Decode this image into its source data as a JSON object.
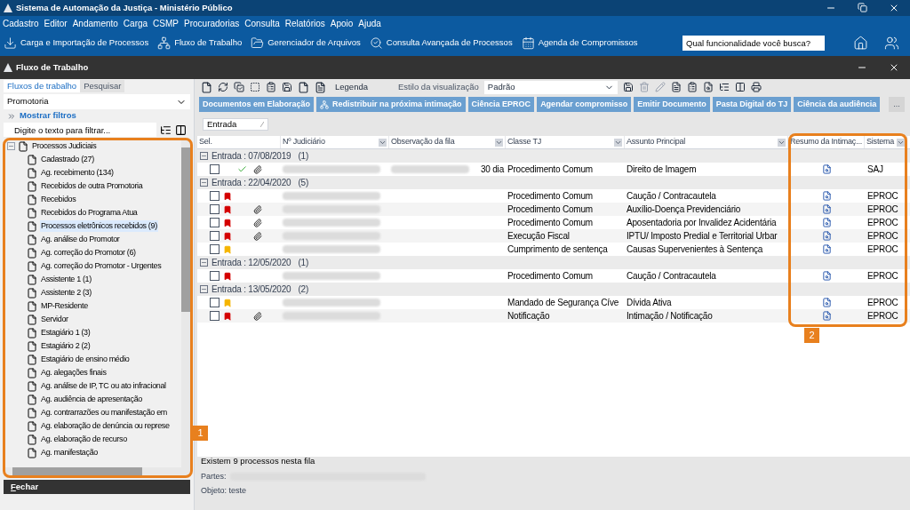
{
  "window": {
    "title": "Sistema de Automação da Justiça - Ministério Público"
  },
  "menu": [
    "Cadastro",
    "Editor",
    "Andamento",
    "Carga",
    "CSMP",
    "Procuradorias",
    "Consulta",
    "Relatórios",
    "Apoio",
    "Ajuda"
  ],
  "toolbar": [
    {
      "kind": "download",
      "label": "Carga e Importação de Processos"
    },
    {
      "kind": "flow",
      "label": "Fluxo de Trabalho"
    },
    {
      "kind": "folder",
      "label": "Gerenciador de Arquivos"
    },
    {
      "kind": "search",
      "label": "Consulta Avançada de Processos"
    },
    {
      "kind": "calendar",
      "label": "Agenda de Compromissos"
    }
  ],
  "search": {
    "placeholder": "Qual funcionalidade você busca?"
  },
  "subwindow": {
    "title": "Fluxo de Trabalho"
  },
  "sidebar": {
    "tabs": [
      {
        "label": "Fluxos de trabalho",
        "selected": true
      },
      {
        "label": "Pesquisar",
        "selected": false
      }
    ],
    "dropdown": "Promotoria",
    "filters_link": "Mostrar filtros",
    "filter": {
      "placeholder": "Digite o texto para filtrar..."
    },
    "tree": [
      {
        "label": "Processos Judiciais",
        "expanded": true,
        "selected": false,
        "children": [
          {
            "label": "Cadastrado (27)",
            "selected": false
          },
          {
            "label": "Ag. recebimento (134)",
            "selected": false
          },
          {
            "label": "Recebidos de outra Promotoria",
            "selected": false
          },
          {
            "label": "Recebidos",
            "selected": false
          },
          {
            "label": "Recebidos do Programa Atua",
            "selected": false
          },
          {
            "label": "Processos eletrônicos recebidos (9)",
            "selected": true
          },
          {
            "label": "Ag. análise do Promotor",
            "selected": false
          },
          {
            "label": "Ag. correção do Promotor (6)",
            "selected": false
          },
          {
            "label": "Ag. correção do Promotor - Urgentes",
            "selected": false
          },
          {
            "label": "Assistente 1 (1)",
            "selected": false
          },
          {
            "label": "Assistente 2 (3)",
            "selected": false
          },
          {
            "label": "MP-Residente",
            "selected": false
          },
          {
            "label": "Servidor",
            "selected": false
          },
          {
            "label": "Estagiário 1 (3)",
            "selected": false
          },
          {
            "label": "Estagiário 2 (2)",
            "selected": false
          },
          {
            "label": "Estagiário de ensino médio",
            "selected": false
          },
          {
            "label": "Ag. alegações finais",
            "selected": false
          },
          {
            "label": "Ag. análise de IP, TC ou ato infracional",
            "selected": false
          },
          {
            "label": "Ag. audiência de apresentação",
            "selected": false
          },
          {
            "label": "Ag. contrarrazões ou manifestação em",
            "selected": false
          },
          {
            "label": "Ag. elaboração de denúncia ou represe",
            "selected": false
          },
          {
            "label": "Ag. elaboração de recurso",
            "selected": false
          },
          {
            "label": "Ag. manifestação",
            "selected": false
          }
        ]
      }
    ],
    "close_button": "Fechar"
  },
  "main": {
    "legend": "Legenda",
    "view_style_label": "Estilo da visualização",
    "view_style": "Padrão",
    "actions": [
      "Documentos em Elaboração",
      "Redistribuir na próxima intimação",
      "Ciência EPROC",
      "Agendar compromisso",
      "Emitir Documento",
      "Pasta Digital do TJ",
      "Ciência da audiência"
    ],
    "more": "...",
    "group_by": "Entrada",
    "table": {
      "columns": [
        "Sel.",
        "Nº Judiciário",
        "Observação da fila",
        "Classe TJ",
        "Assunto Principal",
        "Resumo da Intimaç...",
        "Sistema"
      ],
      "groups": [
        {
          "label": "Entrada : 07/08/2019",
          "count": "(1)",
          "expanded": true,
          "rows": [
            {
              "checked": false,
              "done": true,
              "attachment": true,
              "observation": "30 dia",
              "classe": "Procedimento Comum",
              "assunto": "Direito de Imagem",
              "sistema": "SAJ"
            }
          ]
        },
        {
          "label": "Entrada : 22/04/2020",
          "count": "(5)",
          "expanded": true,
          "rows": [
            {
              "checked": false,
              "flag": {
                "color": "#d40000"
              },
              "done": false,
              "attachment": false,
              "classe": "Procedimento Comum",
              "assunto": "Caução / Contracautela",
              "sistema": "EPROC"
            },
            {
              "checked": false,
              "flag": {
                "color": "#d40000"
              },
              "done": false,
              "attachment": true,
              "classe": "Procedimento Comum",
              "assunto": "Auxílio-Doença Previdenciário",
              "sistema": "EPROC"
            },
            {
              "checked": false,
              "flag": {
                "color": "#d40000"
              },
              "done": false,
              "attachment": true,
              "classe": "Procedimento Comum",
              "assunto": "Aposentadoria por Invalidez Acidentária",
              "sistema": "EPROC"
            },
            {
              "checked": false,
              "flag": {
                "color": "#d40000"
              },
              "done": false,
              "attachment": true,
              "classe": "Execução Fiscal",
              "assunto": "IPTU/ Imposto Predial e Territorial Urbar",
              "sistema": "EPROC"
            },
            {
              "checked": false,
              "flag": {
                "color": "#f5b400"
              },
              "done": false,
              "attachment": false,
              "classe": "Cumprimento de sentença",
              "assunto": "Causas Supervenientes à Sentença",
              "sistema": "EPROC"
            }
          ]
        },
        {
          "label": "Entrada : 12/05/2020",
          "count": "(1)",
          "expanded": true,
          "rows": [
            {
              "checked": false,
              "flag": {
                "color": "#d40000"
              },
              "done": false,
              "attachment": false,
              "classe": "Procedimento Comum",
              "assunto": "Caução / Contracautela",
              "sistema": "EPROC"
            }
          ]
        },
        {
          "label": "Entrada : 13/05/2020",
          "count": "(2)",
          "expanded": true,
          "rows": [
            {
              "checked": false,
              "flag": {
                "color": "#f5b400"
              },
              "done": false,
              "attachment": false,
              "classe": "Mandado de Segurança Cíve",
              "assunto": "Dívida Ativa",
              "sistema": "EPROC"
            },
            {
              "checked": false,
              "flag": {
                "color": "#d40000"
              },
              "done": false,
              "attachment": true,
              "classe": "Notificação",
              "assunto": "Intimação / Notificação",
              "sistema": "EPROC"
            }
          ]
        }
      ]
    },
    "status": "Existem 9 processos nesta fila",
    "parties_label": "Partes:",
    "object": "Objeto: teste"
  },
  "callouts": [
    "1",
    "2"
  ]
}
